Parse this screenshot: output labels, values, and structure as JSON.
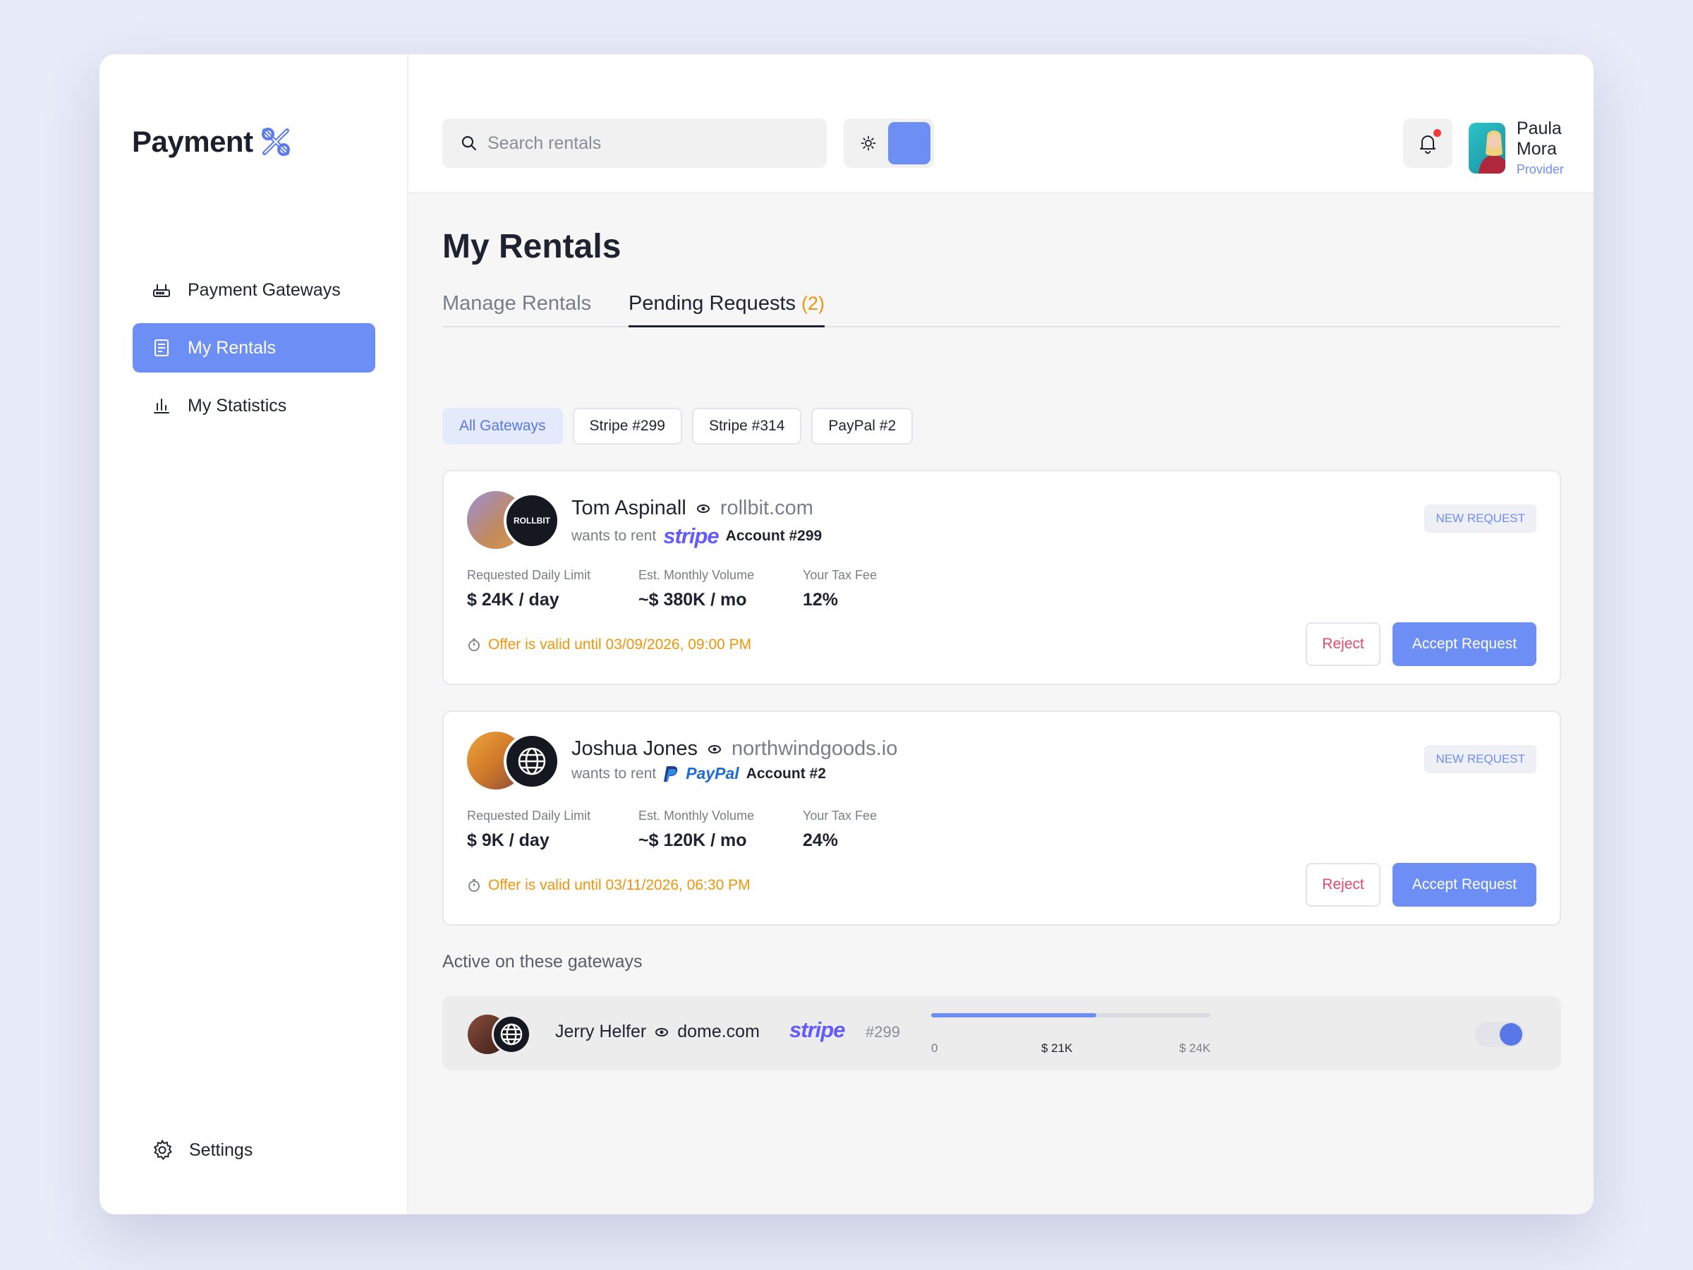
{
  "brand": {
    "name": "Payment"
  },
  "sidebar": {
    "items": [
      {
        "label": "Payment Gateways",
        "icon": "router-icon",
        "active": false
      },
      {
        "label": "My Rentals",
        "icon": "document-icon",
        "active": true
      },
      {
        "label": "My Statistics",
        "icon": "bar-chart-icon",
        "active": false
      }
    ],
    "settings_label": "Settings"
  },
  "topbar": {
    "search_placeholder": "Search rentals",
    "theme_icon": "sun-icon",
    "notification_icon": "bell-icon",
    "user": {
      "name": "Paula Mora",
      "role": "Provider"
    }
  },
  "main": {
    "title": "My Rentals",
    "tabs": [
      {
        "label": "Manage Rentals",
        "active": false
      },
      {
        "label": "Pending Requests",
        "count": "(2)",
        "active": true
      }
    ],
    "filters": [
      {
        "label": "All Gateways",
        "active": true
      },
      {
        "label": "Stripe #299",
        "active": false
      },
      {
        "label": "Stripe #314",
        "active": false
      },
      {
        "label": "PayPal #2",
        "active": false
      }
    ],
    "requests": [
      {
        "name": "Tom Aspinall",
        "domain": "rollbit.com",
        "brand_label": "ROLLBIT",
        "wants_text": "wants to rent",
        "gateway": "stripe",
        "account": "Account #299",
        "badge": "NEW REQUEST",
        "stats": [
          {
            "label": "Requested Daily Limit",
            "value": "$ 24K / day"
          },
          {
            "label": "Est. Monthly Volume",
            "value": "~$ 380K / mo"
          },
          {
            "label": "Your Tax Fee",
            "value": "12%"
          }
        ],
        "offer": "Offer is valid until 03/09/2026, 09:00 PM",
        "reject_label": "Reject",
        "accept_label": "Accept Request"
      },
      {
        "name": "Joshua Jones",
        "domain": "northwindgoods.io",
        "wants_text": "wants to rent",
        "gateway": "PayPal",
        "account": "Account #2",
        "badge": "NEW REQUEST",
        "stats": [
          {
            "label": "Requested Daily Limit",
            "value": "$ 9K / day"
          },
          {
            "label": "Est. Monthly Volume",
            "value": "~$ 120K / mo"
          },
          {
            "label": "Your Tax Fee",
            "value": "24%"
          }
        ],
        "offer": "Offer is valid until 03/11/2026, 06:30 PM",
        "reject_label": "Reject",
        "accept_label": "Accept Request"
      }
    ],
    "active_section_title": "Active on these gateways",
    "active": [
      {
        "name": "Jerry Helfer",
        "domain": "dome.com",
        "gateway": "stripe",
        "account": "#299",
        "progress": {
          "min": "0",
          "current": "$ 21K",
          "max": "$ 24K",
          "fraction": 0.59
        },
        "enabled": true
      }
    ]
  },
  "colors": {
    "accent": "#6d8ff5",
    "warning": "#f0940a",
    "reject": "#e04a6b",
    "stripe": "#635bff",
    "paypal": "#1f6bd6"
  }
}
